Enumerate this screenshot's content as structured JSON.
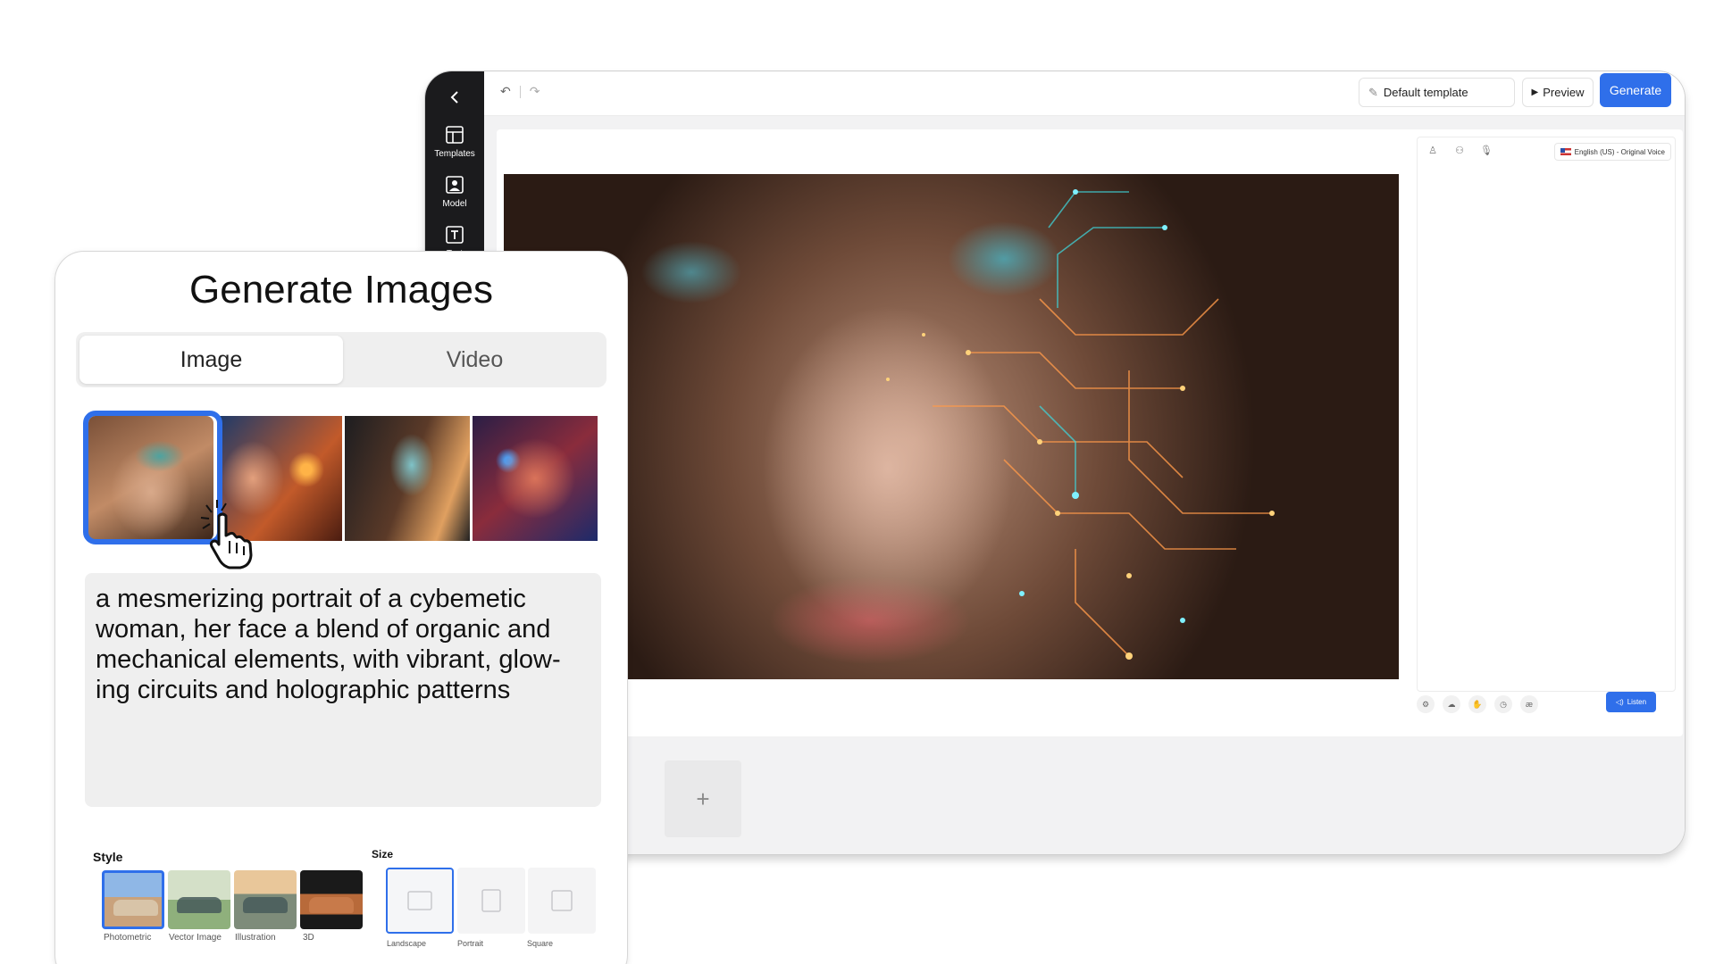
{
  "editor": {
    "rail": {
      "items": [
        {
          "label": "Templates",
          "icon": "templates-icon"
        },
        {
          "label": "Model",
          "icon": "model-icon"
        },
        {
          "label": "Text",
          "icon": "text-icon"
        }
      ]
    },
    "toolbar": {
      "template_label": "Default template",
      "preview_label": "Preview",
      "generate_label": "Generate"
    },
    "side_panel": {
      "language_label": "English (US) - Original Voice",
      "listen_label": "Listen"
    },
    "filmstrip": {
      "add_label": "+"
    }
  },
  "generate_card": {
    "title": "Generate Images",
    "tabs": [
      {
        "label": "Image",
        "active": true
      },
      {
        "label": "Video",
        "active": false
      }
    ],
    "prompt": "a mesmerizing portrait of a cybemetic woman, her face a blend of organic and mechanical elements, with vibrant, glow-ing circuits and holographic patterns",
    "style": {
      "label": "Style",
      "options": [
        "Photometric",
        "Vector Image",
        "Illustration",
        "3D"
      ],
      "selected": "Photometric"
    },
    "size": {
      "label": "Size",
      "options": [
        "Landscape",
        "Portrait",
        "Square"
      ],
      "selected": "Landscape"
    }
  },
  "colors": {
    "accent": "#2f6fea",
    "rail_bg": "#1b1b1d",
    "panel_bg": "#efefef"
  }
}
